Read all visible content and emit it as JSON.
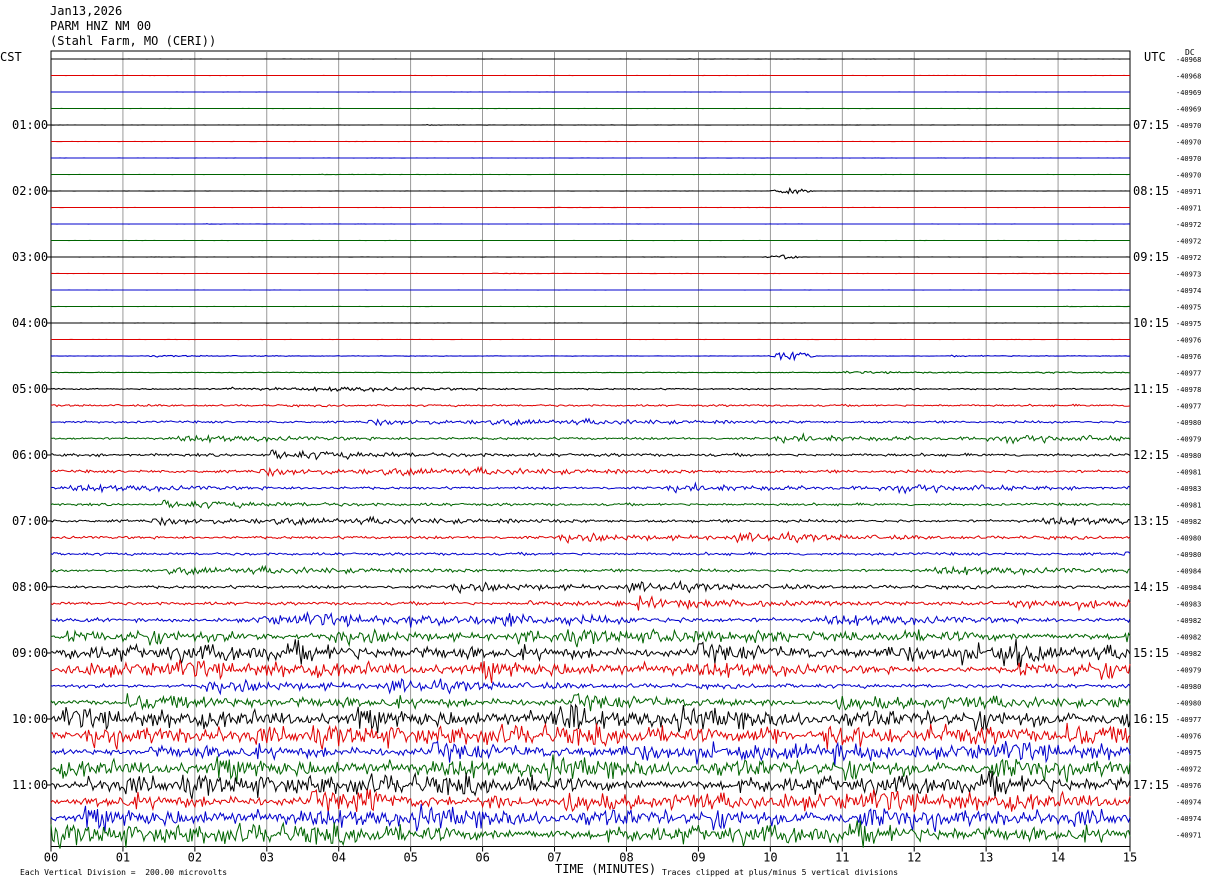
{
  "header": {
    "date": "Jan13,2026",
    "station": "PARM HNZ NM 00",
    "location": "(Stahl Farm, MO (CERI))"
  },
  "labels": {
    "left_zone": "CST",
    "right_zone": "UTC",
    "dc": "DC",
    "xlabel": "TIME (MINUTES)",
    "footer_scale": "Each Vertical Division =  200.00 microvolts",
    "footer_clip": "Traces clipped at plus/minus 5 vertical divisions"
  },
  "colors": {
    "trace_cycle": [
      "#000000",
      "#e00000",
      "#0000cc",
      "#006400"
    ],
    "grid": "#808080"
  },
  "chart_data": {
    "type": "line",
    "title": "PARM HNZ NM 00",
    "xlabel": "TIME (MINUTES)",
    "x_ticks": [
      "00",
      "01",
      "02",
      "03",
      "04",
      "05",
      "06",
      "07",
      "08",
      "09",
      "10",
      "11",
      "12",
      "13",
      "14",
      "15"
    ],
    "xlim": [
      0,
      15
    ],
    "minutes_per_line": 15,
    "left_time_labels": [
      "01:00",
      "02:00",
      "03:00",
      "04:00",
      "05:00",
      "06:00",
      "07:00",
      "08:00",
      "09:00",
      "10:00",
      "11:00"
    ],
    "right_time_labels": [
      "07:15",
      "08:15",
      "09:15",
      "10:15",
      "11:15",
      "12:15",
      "13:15",
      "14:15",
      "15:15",
      "16:15",
      "17:15"
    ],
    "hour_label_line_index": [
      4,
      8,
      12,
      16,
      20,
      24,
      28,
      32,
      36,
      40,
      44
    ],
    "dc_offsets": [
      "-40968",
      "-40968",
      "-40969",
      "-40969",
      "-40970",
      "-40970",
      "-40970",
      "-40970",
      "-40971",
      "-40971",
      "-40972",
      "-40972",
      "-40972",
      "-40973",
      "-40974",
      "-40975",
      "-40975",
      "-40976",
      "-40976",
      "-40977",
      "-40978",
      "-40977",
      "-40980",
      "-40979",
      "-40980",
      "-40981",
      "-40983",
      "-40981",
      "-40982",
      "-40980",
      "-40980",
      "-40984",
      "-40984",
      "-40983",
      "-40982",
      "-40982",
      "-40982",
      "-40979",
      "-40980",
      "-40980",
      "-40977",
      "-40976",
      "-40975",
      "-40972",
      "-40976",
      "-40974",
      "-40974",
      "-40971"
    ],
    "trace_activity": [
      0.1,
      0.1,
      0.1,
      0.1,
      0.15,
      0.12,
      0.12,
      0.1,
      0.15,
      0.1,
      0.1,
      0.1,
      0.12,
      0.1,
      0.1,
      0.1,
      0.12,
      0.12,
      0.35,
      0.5,
      1.0,
      1.6,
      1.8,
      1.8,
      2.3,
      2.3,
      1.9,
      2.0,
      2.2,
      2.2,
      2.2,
      2.3,
      2.4,
      2.6,
      3.0,
      3.6,
      4.6,
      4.2,
      3.2,
      3.8,
      5.0,
      5.2,
      4.6,
      5.0,
      5.2,
      5.0,
      5.0,
      5.2
    ],
    "events": [
      {
        "line": 8,
        "minute": 10.3,
        "amp": 3
      },
      {
        "line": 12,
        "minute": 10.2,
        "amp": 2
      },
      {
        "line": 18,
        "minute": 10.3,
        "amp": 6
      },
      {
        "line": 36,
        "minute": 13.4,
        "amp": 12
      },
      {
        "line": 40,
        "minute": 7.2,
        "amp": 14
      },
      {
        "line": 41,
        "minute": 10.0,
        "amp": 12
      },
      {
        "line": 45,
        "minute": 4.4,
        "amp": 12
      }
    ],
    "scale": "200.00 microvolts per vertical division",
    "clip": "plus/minus 5 vertical divisions"
  }
}
